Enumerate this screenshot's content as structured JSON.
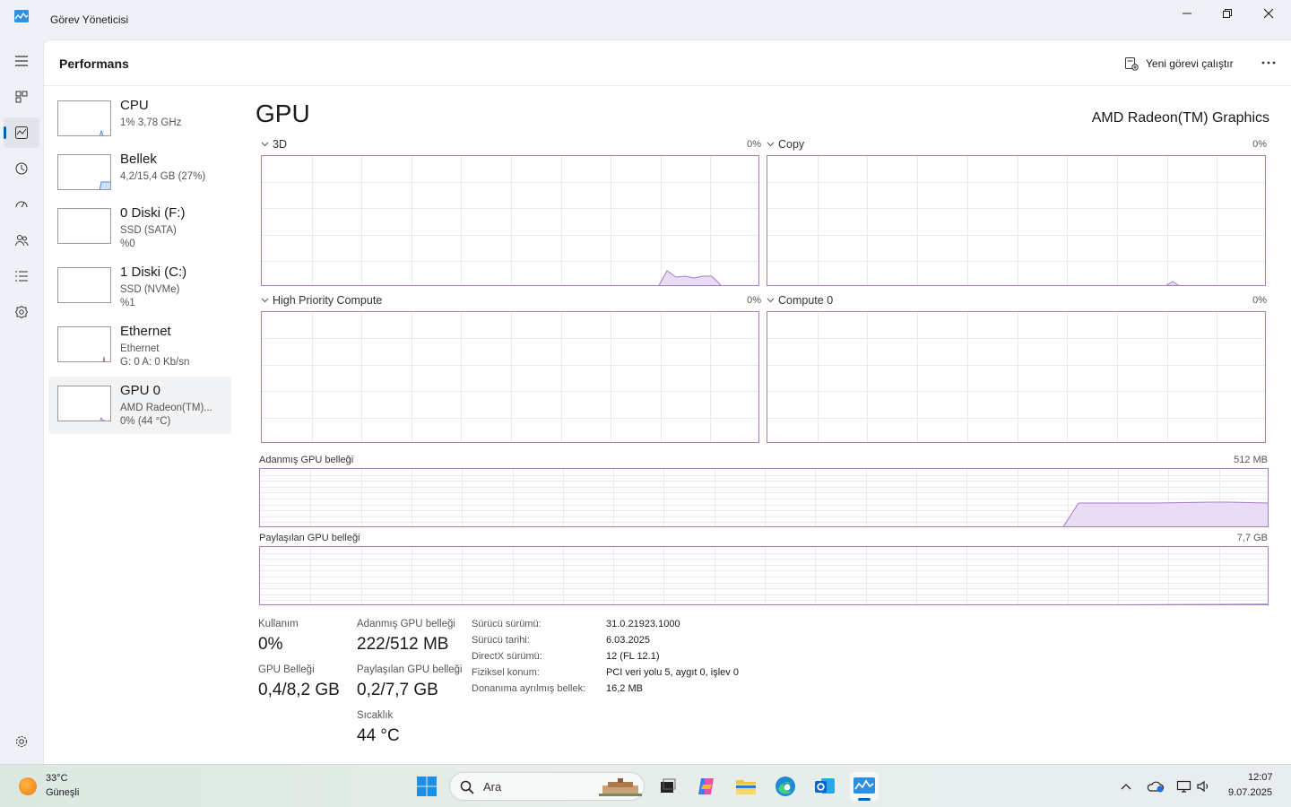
{
  "window": {
    "title": "Görev Yöneticisi"
  },
  "header": {
    "title": "Performans",
    "run_task_label": "Yeni görevi çalıştır"
  },
  "devices": [
    {
      "title": "CPU",
      "sub1": "1% 3,78 GHz",
      "sub2": ""
    },
    {
      "title": "Bellek",
      "sub1": "4,2/15,4 GB (27%)",
      "sub2": ""
    },
    {
      "title": "0 Diski (F:)",
      "sub1": "SSD (SATA)",
      "sub2": "%0"
    },
    {
      "title": "1 Diski (C:)",
      "sub1": "SSD (NVMe)",
      "sub2": "%1"
    },
    {
      "title": "Ethernet",
      "sub1": "Ethernet",
      "sub2": "G: 0 A: 0 Kb/sn"
    },
    {
      "title": "GPU 0",
      "sub1": "AMD Radeon(TM)...",
      "sub2": "0% (44 °C)"
    }
  ],
  "gpu": {
    "title": "GPU",
    "name": "AMD Radeon(TM) Graphics",
    "engines": [
      {
        "label": "3D",
        "value": "0%"
      },
      {
        "label": "Copy",
        "value": "0%"
      },
      {
        "label": "High Priority Compute",
        "value": "0%"
      },
      {
        "label": "Compute 0",
        "value": "0%"
      }
    ],
    "dedicated_label": "Adanmış GPU belleği",
    "dedicated_max": "512 MB",
    "shared_label": "Paylaşılan GPU belleği",
    "shared_max": "7,7 GB"
  },
  "stats": {
    "usage_label": "Kullanım",
    "usage_value": "0%",
    "gpu_mem_label": "GPU Belleği",
    "gpu_mem_value": "0,4/8,2 GB",
    "dedicated_label": "Adanmış GPU belleği",
    "dedicated_value": "222/512 MB",
    "shared_label": "Paylaşılan GPU belleği",
    "shared_value": "0,2/7,7 GB",
    "temp_label": "Sıcaklık",
    "temp_value": "44 °C"
  },
  "info": [
    {
      "key": "Sürücü sürümü:",
      "value": "31.0.21923.1000"
    },
    {
      "key": "Sürücü tarihi:",
      "value": "6.03.2025"
    },
    {
      "key": "DirectX sürümü:",
      "value": "12 (FL 12.1)"
    },
    {
      "key": "Fiziksel konum:",
      "value": "PCI veri yolu 5, aygıt 0, işlev 0"
    },
    {
      "key": "Donanıma ayrılmış bellek:",
      "value": "16,2 MB"
    }
  ],
  "taskbar": {
    "weather_temp": "33°C",
    "weather_desc": "Güneşli",
    "search_placeholder": "Ara",
    "time": "12:07",
    "date": "9.07.2025"
  },
  "colors": {
    "accent": "#005fb8",
    "gpu_line": "#a47dc4",
    "gpu_fill": "#e9dcf5"
  }
}
